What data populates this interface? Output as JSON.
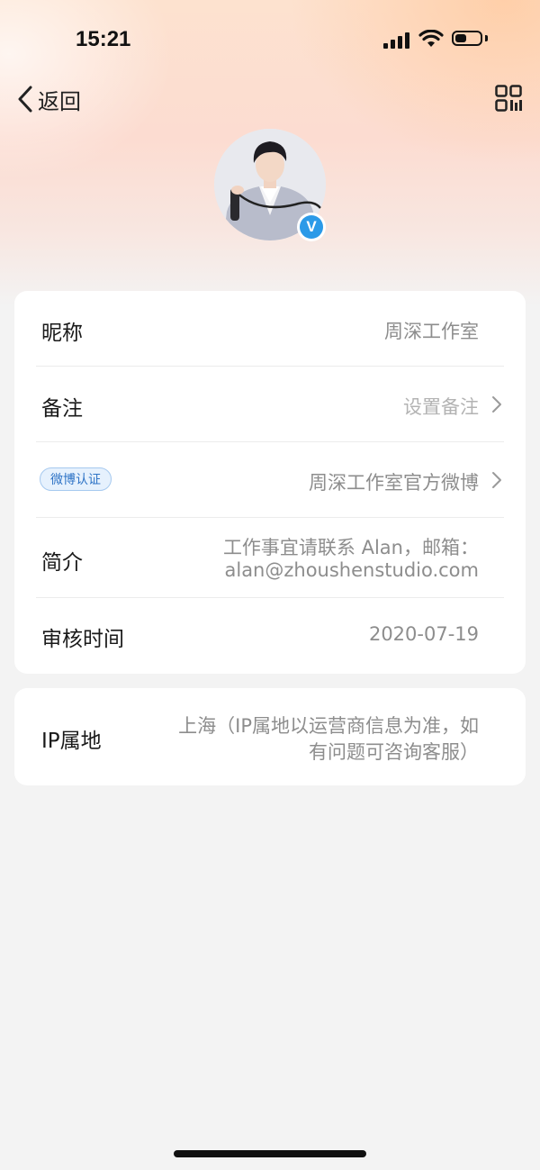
{
  "status_bar": {
    "time": "15:21"
  },
  "nav": {
    "back_label": "返回"
  },
  "profile": {
    "verified_mark": "V",
    "rows": {
      "nickname": {
        "label": "昵称",
        "value": "周深工作室"
      },
      "remark": {
        "label": "备注",
        "value": "设置备注"
      },
      "verification": {
        "badge": "微博认证",
        "value": "周深工作室官方微博"
      },
      "bio": {
        "label": "简介",
        "value_line1": "工作事宜请联系 Alan，邮箱：",
        "value_line2": "alan@zhoushenstudio.com"
      },
      "review_time": {
        "label": "审核时间",
        "value": "2020-07-19"
      }
    },
    "ip": {
      "label": "IP属地",
      "value_line1": "上海（IP属地以运营商信息为准，如",
      "value_line2": "有问题可咨询客服）"
    }
  },
  "colors": {
    "accent": "#2b9ae8",
    "badge_text": "#2f74c6",
    "value_text": "#8d8d8d",
    "background": "#f3f3f3"
  }
}
